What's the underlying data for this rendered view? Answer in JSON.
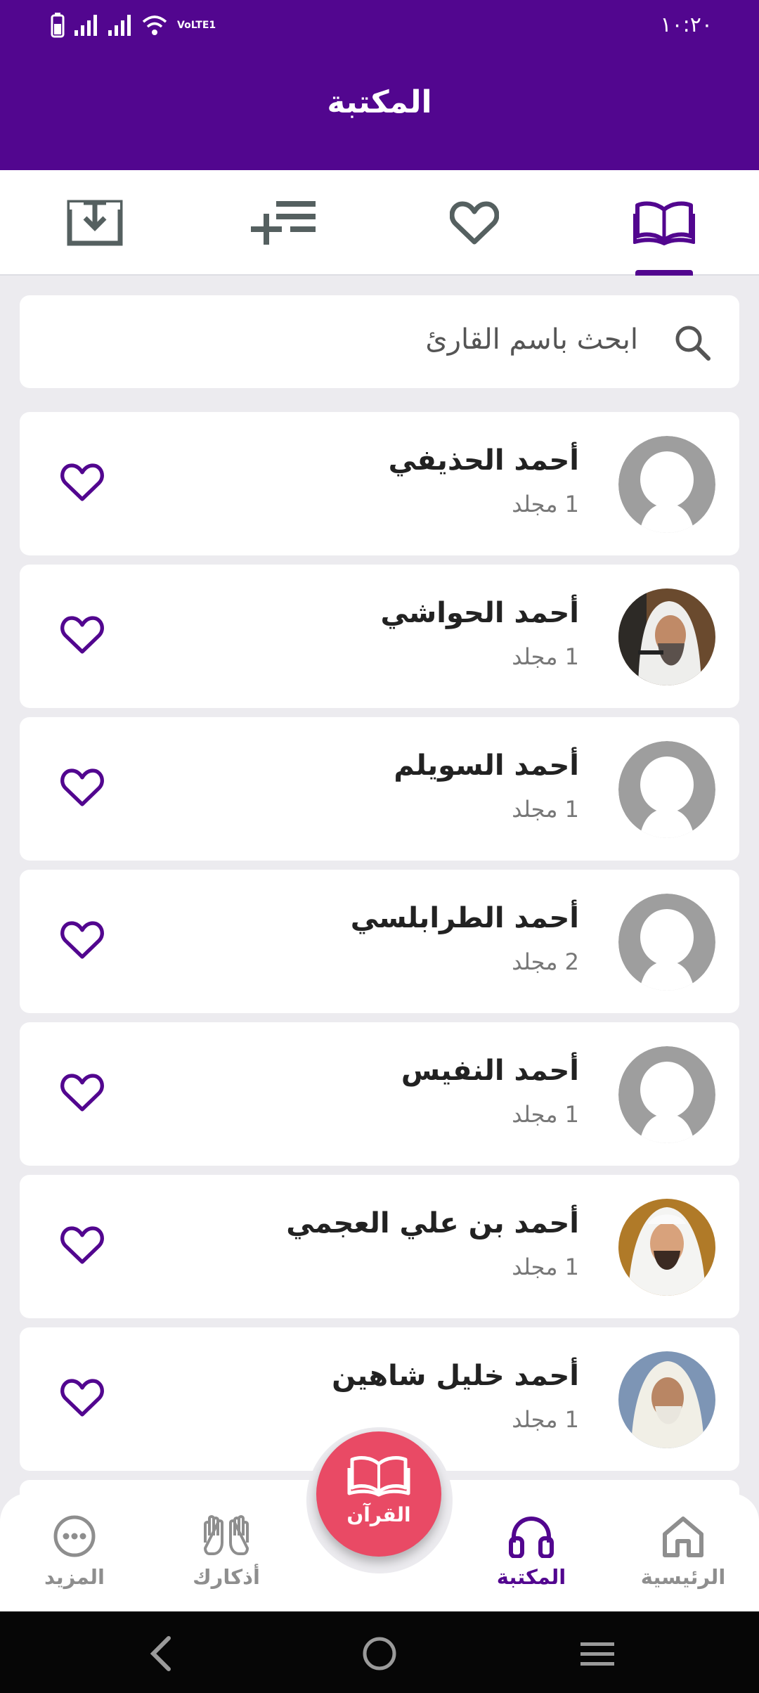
{
  "status_bar": {
    "time": "١٠:٢٠",
    "network_label": "VoLTE1"
  },
  "header": {
    "title": "المكتبة"
  },
  "tabs": [
    {
      "id": "library",
      "icon": "open-book-icon",
      "active": true
    },
    {
      "id": "favorites",
      "icon": "heart-icon",
      "active": false
    },
    {
      "id": "playlists",
      "icon": "playlist-add-icon",
      "active": false
    },
    {
      "id": "downloads",
      "icon": "download-icon",
      "active": false
    }
  ],
  "search": {
    "placeholder": "ابحث باسم القارئ"
  },
  "reciters": [
    {
      "name": "أحمد الحذيفي",
      "count": "1 مجلد",
      "avatar": "placeholder"
    },
    {
      "name": "أحمد الحواشي",
      "count": "1 مجلد",
      "avatar": "photo"
    },
    {
      "name": "أحمد السويلم",
      "count": "1 مجلد",
      "avatar": "placeholder"
    },
    {
      "name": "أحمد الطرابلسي",
      "count": "2 مجلد",
      "avatar": "placeholder"
    },
    {
      "name": "أحمد النفيس",
      "count": "1 مجلد",
      "avatar": "placeholder"
    },
    {
      "name": "أحمد بن علي العجمي",
      "count": "1 مجلد",
      "avatar": "photo"
    },
    {
      "name": "أحمد خليل شاهين",
      "count": "1 مجلد",
      "avatar": "photo"
    }
  ],
  "bottom_nav": {
    "home": "الرئيسية",
    "library": "المكتبة",
    "quran": "القرآن",
    "adhkar": "أذكارك",
    "more": "المزيد",
    "active": "library"
  },
  "colors": {
    "primary": "#52068f",
    "accent": "#e94a65",
    "background": "#ecebef"
  }
}
